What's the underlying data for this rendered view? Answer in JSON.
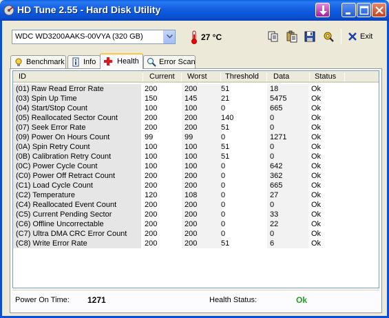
{
  "window": {
    "title": "HD Tune 2.55 - Hard Disk Utility",
    "icons": {
      "app": "hdtune-app-icon",
      "special": "download-arrow-icon",
      "minimize": "minimize-icon",
      "maximize": "maximize-icon",
      "close": "close-icon"
    }
  },
  "toolbar": {
    "drive": "WDC WD3200AAKS-00VYA (320 GB)",
    "temperature": "27 °C",
    "exit_label": "Exit",
    "icons": [
      "copy-icon",
      "paste-icon",
      "save-icon",
      "options-icon",
      "exit-icon",
      "thermometer-icon"
    ]
  },
  "tabs": [
    {
      "label": "Benchmark",
      "icon": "benchmark-icon",
      "active": false
    },
    {
      "label": "Info",
      "icon": "info-icon",
      "active": false
    },
    {
      "label": "Health",
      "icon": "health-cross-icon",
      "active": true
    },
    {
      "label": "Error Scan",
      "icon": "magnifier-icon",
      "active": false
    }
  ],
  "table": {
    "columns": [
      "ID",
      "Current",
      "Worst",
      "Threshold",
      "Data",
      "Status"
    ],
    "rows": [
      [
        "(01) Raw Read Error Rate",
        "200",
        "200",
        "51",
        "18",
        "Ok"
      ],
      [
        "(03) Spin Up Time",
        "150",
        "145",
        "21",
        "5475",
        "Ok"
      ],
      [
        "(04) Start/Stop Count",
        "100",
        "100",
        "0",
        "665",
        "Ok"
      ],
      [
        "(05) Reallocated Sector Count",
        "200",
        "200",
        "140",
        "0",
        "Ok"
      ],
      [
        "(07) Seek Error Rate",
        "200",
        "200",
        "51",
        "0",
        "Ok"
      ],
      [
        "(09) Power On Hours Count",
        "99",
        "99",
        "0",
        "1271",
        "Ok"
      ],
      [
        "(0A) Spin Retry Count",
        "100",
        "100",
        "51",
        "0",
        "Ok"
      ],
      [
        "(0B) Calibration Retry Count",
        "100",
        "100",
        "51",
        "0",
        "Ok"
      ],
      [
        "(0C) Power Cycle Count",
        "100",
        "100",
        "0",
        "642",
        "Ok"
      ],
      [
        "(C0) Power Off Retract Count",
        "200",
        "200",
        "0",
        "362",
        "Ok"
      ],
      [
        "(C1) Load Cycle Count",
        "200",
        "200",
        "0",
        "665",
        "Ok"
      ],
      [
        "(C2) Temperature",
        "120",
        "108",
        "0",
        "27",
        "Ok"
      ],
      [
        "(C4) Reallocated Event Count",
        "200",
        "200",
        "0",
        "0",
        "Ok"
      ],
      [
        "(C5) Current Pending Sector",
        "200",
        "200",
        "0",
        "33",
        "Ok"
      ],
      [
        "(C6) Offline Uncorrectable",
        "200",
        "200",
        "0",
        "22",
        "Ok"
      ],
      [
        "(C7) Ultra DMA CRC Error Count",
        "200",
        "200",
        "0",
        "0",
        "Ok"
      ],
      [
        "(C8) Write Error Rate",
        "200",
        "200",
        "51",
        "6",
        "Ok"
      ]
    ]
  },
  "footer": {
    "power_on_label": "Power On Time:",
    "power_on_value": "1271",
    "health_status_label": "Health Status:",
    "health_status_value": "Ok",
    "health_status_color": "#1f9e1f"
  }
}
